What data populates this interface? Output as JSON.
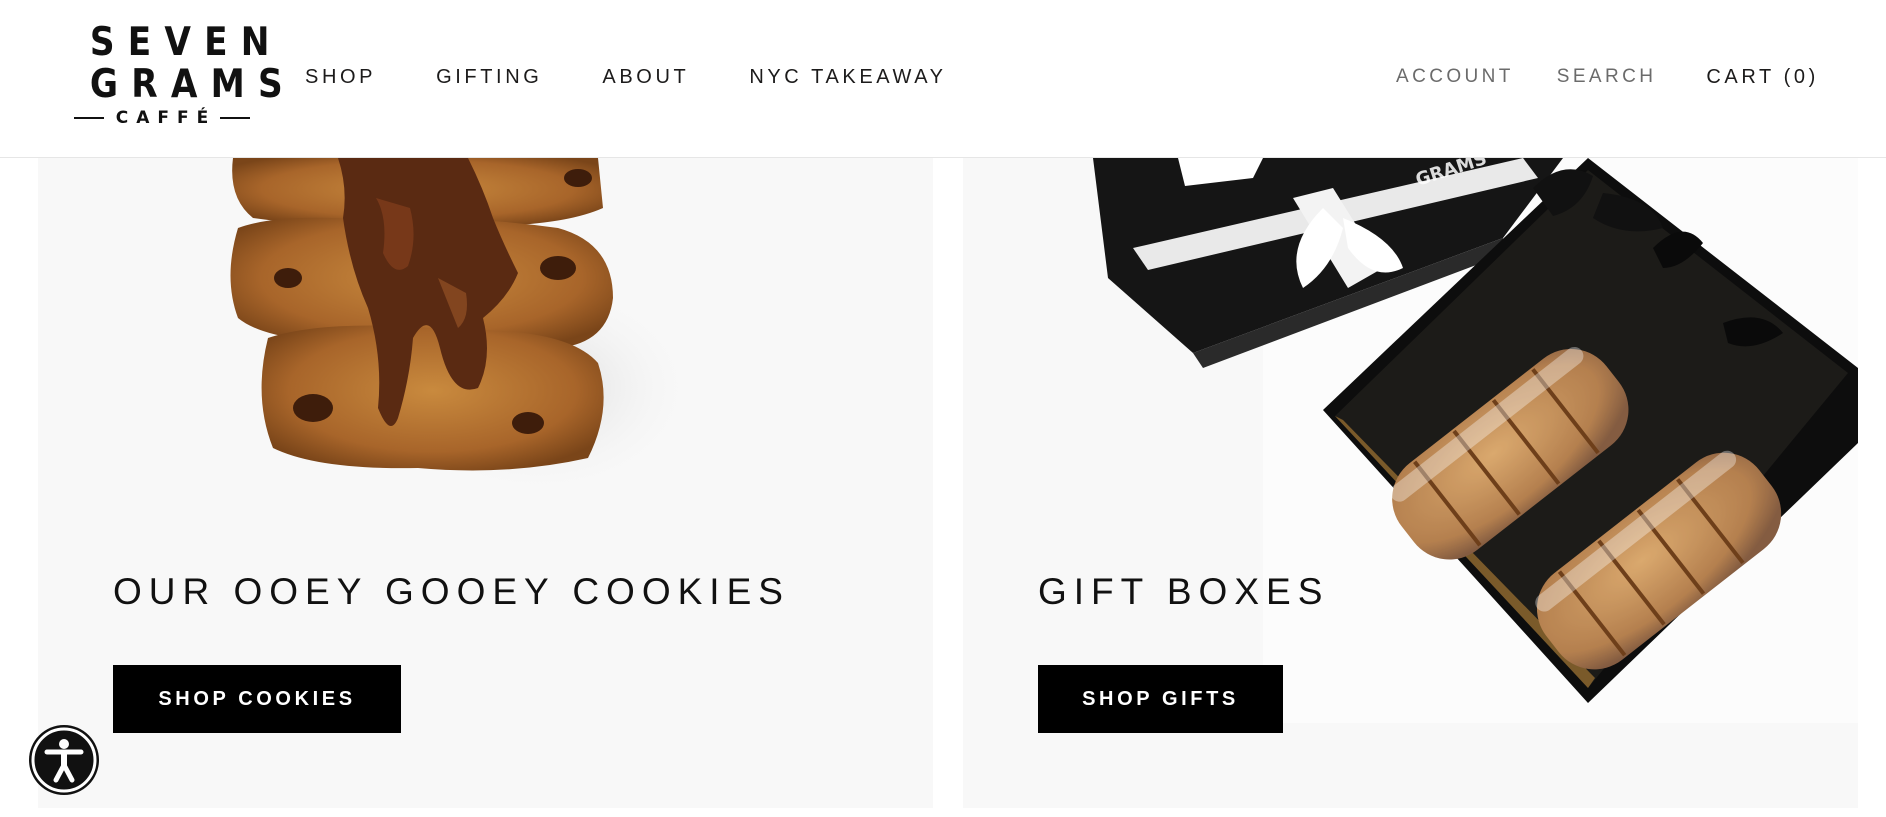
{
  "brand": {
    "logo_line1": "SEVEN",
    "logo_line2": "GRAMS",
    "logo_sub": "CAFFÉ"
  },
  "nav": {
    "items": [
      {
        "label": "SHOP"
      },
      {
        "label": "GIFTING"
      },
      {
        "label": "ABOUT"
      },
      {
        "label": "NYC TAKEAWAY"
      }
    ]
  },
  "header_right": {
    "account": "ACCOUNT",
    "search": "SEARCH",
    "cart": "CART (0)"
  },
  "panels": [
    {
      "title": "OUR OOEY GOOEY COOKIES",
      "button": "SHOP COOKIES",
      "image": "stacked-cookies-image"
    },
    {
      "title": "GIFT BOXES",
      "button": "SHOP GIFTS",
      "image": "gift-box-image"
    }
  ],
  "accessibility": {
    "icon": "accessibility-icon"
  },
  "colors": {
    "button_bg": "#000000",
    "panel_bg": "#f8f8f8",
    "text": "#1c1b1b",
    "muted": "#6b6b6b"
  }
}
